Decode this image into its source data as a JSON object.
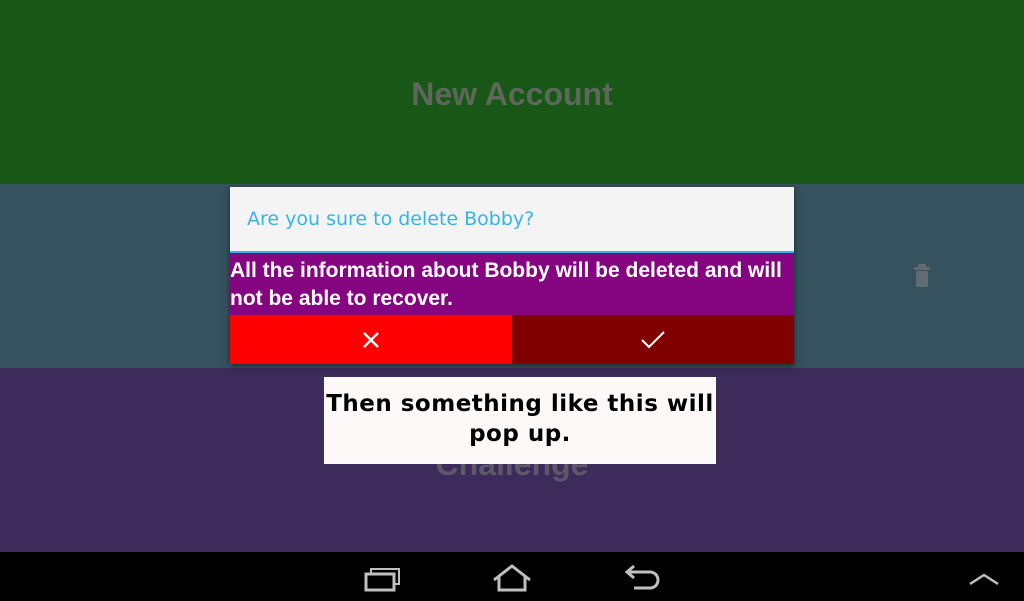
{
  "panels": {
    "new_account": {
      "title": "New Account",
      "color": "#185716"
    },
    "bobby": {
      "color": "#36525e",
      "trash_icon": "trash-icon"
    },
    "challenge": {
      "title": "Challenge",
      "color": "#3c2b5b"
    }
  },
  "dialog": {
    "title": "Are you sure to delete Bobby?",
    "message": "All the information about Bobby will be deleted and will not be able to recover.",
    "cancel_icon": "close-icon",
    "confirm_icon": "check-icon",
    "colors": {
      "title": "#33b5e5",
      "body": "#85047f",
      "cancel": "#ff0000",
      "confirm": "#800000"
    }
  },
  "annotation": {
    "text": "Then something like this will pop up."
  },
  "navbar": {
    "icons": [
      "recent-apps-icon",
      "home-icon",
      "back-icon",
      "chevron-up-icon"
    ]
  }
}
